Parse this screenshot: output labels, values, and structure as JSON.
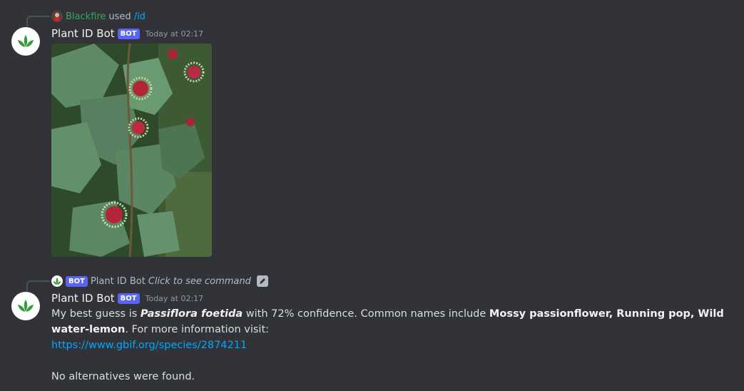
{
  "message1": {
    "reply_user": "Blackfire",
    "reply_used": "used",
    "reply_command": "/id",
    "author": "Plant ID Bot",
    "bot_tag": "BOT",
    "timestamp": "Today at 02:17"
  },
  "message2": {
    "reply_bot_tag": "BOT",
    "reply_author": "Plant ID Bot",
    "reply_click": "Click to see command",
    "author": "Plant ID Bot",
    "bot_tag": "BOT",
    "timestamp": "Today at 02:17",
    "text_intro": "My best guess is ",
    "species": "Passiflora foetida",
    "text_conf": " with 72% confidence. Common names include ",
    "common_names": "Mossy passionflower, Running pop, Wild water-lemon",
    "text_more": ". For more information visit:",
    "link": "https://www.gbif.org/species/2874211",
    "alternatives": "No alternatives were found."
  },
  "colors": {
    "background": "#313338",
    "brand": "#5865f2",
    "link": "#00a8fc",
    "username_green": "#3ba55c"
  },
  "icons": [
    "plant-logo-icon",
    "edit-icon"
  ]
}
